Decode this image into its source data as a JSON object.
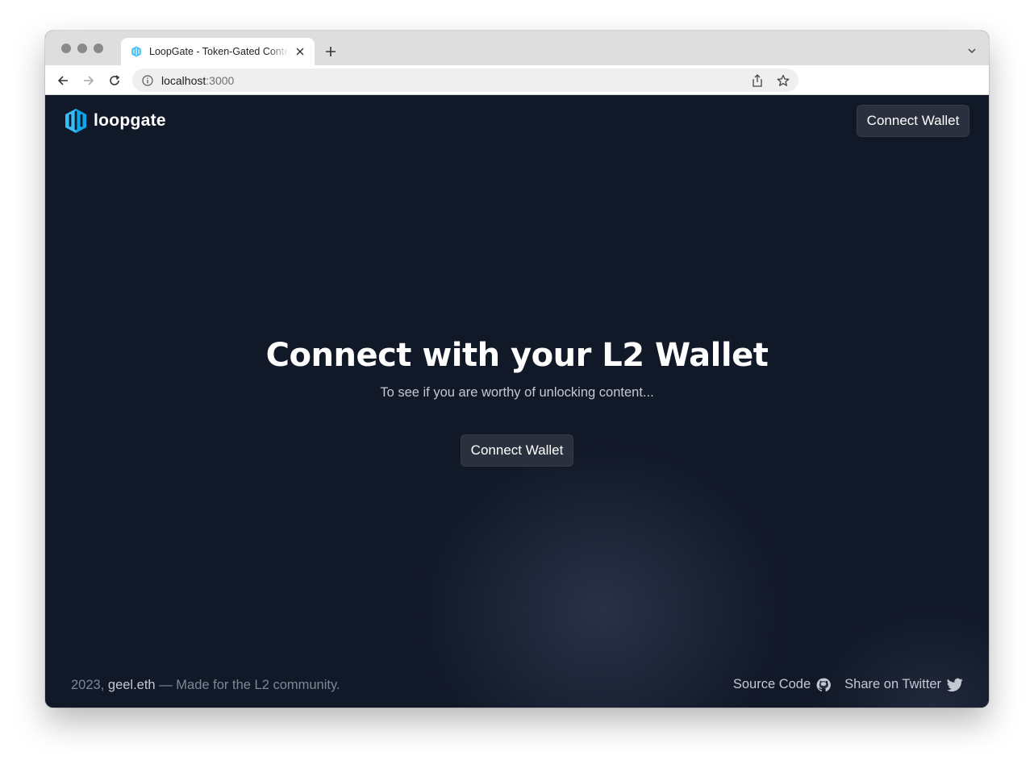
{
  "browser": {
    "tab_title": "LoopGate - Token-Gated Content",
    "url_host": "localhost",
    "url_port": ":3000"
  },
  "header": {
    "logo_text": "loopgate",
    "connect_label": "Connect Wallet"
  },
  "hero": {
    "title": "Connect with your L2 Wallet",
    "subtitle": "To see if you are worthy of unlocking content...",
    "connect_label": "Connect Wallet"
  },
  "footer": {
    "year": "2023,",
    "author": "geel.eth",
    "dash": "—",
    "tagline": "Made for the L2 community.",
    "source_label": "Source Code",
    "share_label": "Share on Twitter"
  },
  "icons": {
    "logo": "loopgate-logo-icon",
    "github": "github-icon",
    "twitter": "twitter-icon"
  },
  "colors": {
    "page_background": "#111827",
    "button_background": "#2a303d",
    "logo_accent": "#38bdf8"
  }
}
